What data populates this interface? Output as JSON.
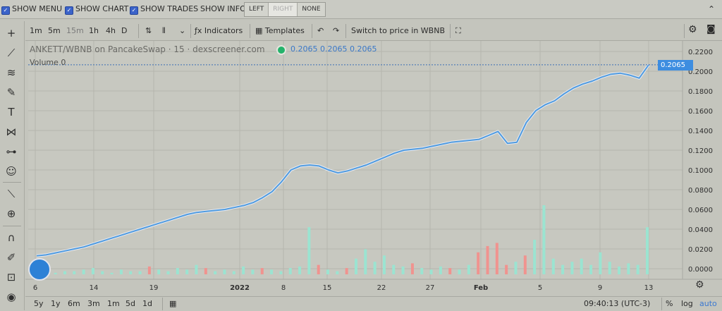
{
  "topbar": {
    "show_menu": "SHOW MENU",
    "show_chart": "SHOW CHART",
    "show_trades": "SHOW TRADES",
    "show_info": "SHOW INFO:",
    "info_options": [
      "LEFT",
      "RIGHT",
      "NONE"
    ],
    "info_selected": "RIGHT",
    "collapse_icon": "chevron-up-icon"
  },
  "toolbar": {
    "intervals": [
      "1m",
      "5m",
      "15m",
      "1h",
      "4h",
      "D"
    ],
    "selected_interval": "15m",
    "indicators_label": "Indicators",
    "templates_label": "Templates",
    "switch_label": "Switch to price in WBNB",
    "icons": [
      "candles-icon",
      "bar-type-icon",
      "chevron-down-icon",
      "indicators-icon",
      "templates-icon",
      "undo-icon",
      "redo-icon",
      "fullscreen-icon",
      "gear-icon",
      "camera-icon"
    ]
  },
  "left_tools": [
    "crosshair-icon",
    "trendline-icon",
    "fib-icon",
    "brush-icon",
    "text-icon",
    "pattern-icon",
    "projection-icon",
    "emoji-icon",
    "ruler-icon",
    "zoom-icon",
    "magnet-icon",
    "lock-draw-icon",
    "lock-icon",
    "eye-icon"
  ],
  "legend": {
    "title": "ANKETT/WBNB on PancakeSwap · 15 · dexscreener.com",
    "ohlc": "0.2065 0.2065 0.2065",
    "volume": "Volume 0"
  },
  "price_label": "0.2065",
  "colors": {
    "price_line": "#4f9be0",
    "volume_up": "#9be4d1",
    "volume_down": "#f0938f",
    "accent": "#3d8de0"
  },
  "chart_data": {
    "type": "line",
    "x_ticks": [
      "6",
      "14",
      "19",
      "2022",
      "8",
      "15",
      "22",
      "27",
      "Feb",
      "5",
      "9",
      "13"
    ],
    "y_ticks": [
      "0.2200",
      "0.2000",
      "0.1800",
      "0.1600",
      "0.1400",
      "0.1200",
      "0.1000",
      "0.0800",
      "0.0600",
      "0.0400",
      "0.0200",
      "0.0000"
    ],
    "ylim": [
      0,
      0.22
    ],
    "series": [
      {
        "values": [
          0.013,
          0.014,
          0.016,
          0.018,
          0.02,
          0.022,
          0.025,
          0.028,
          0.031,
          0.034,
          0.037,
          0.04,
          0.043,
          0.046,
          0.049,
          0.052,
          0.055,
          0.057,
          0.058,
          0.059,
          0.06,
          0.062,
          0.064,
          0.067,
          0.072,
          0.078,
          0.088,
          0.1,
          0.104,
          0.105,
          0.104,
          0.1,
          0.097,
          0.099,
          0.102,
          0.105,
          0.109,
          0.113,
          0.117,
          0.12,
          0.121,
          0.122,
          0.124,
          0.126,
          0.128,
          0.129,
          0.13,
          0.131,
          0.135,
          0.139,
          0.127,
          0.128,
          0.148,
          0.16,
          0.166,
          0.17,
          0.177,
          0.183,
          0.187,
          0.19,
          0.194,
          0.197,
          0.198,
          0.196,
          0.193,
          0.2065
        ]
      }
    ],
    "volume": [
      2,
      3,
      1,
      2,
      2,
      3,
      4,
      2,
      1,
      3,
      2,
      2,
      5,
      3,
      2,
      4,
      3,
      6,
      4,
      2,
      3,
      2,
      5,
      3,
      4,
      3,
      2,
      4,
      5,
      30,
      6,
      3,
      2,
      4,
      10,
      16,
      8,
      12,
      6,
      5,
      7,
      4,
      3,
      5,
      4,
      3,
      6,
      14,
      18,
      20,
      6,
      8,
      12,
      22,
      44,
      10,
      6,
      8,
      10,
      6,
      14,
      8,
      5,
      7,
      6,
      30
    ],
    "volume_down_indices": [
      12,
      18,
      24,
      30,
      33,
      40,
      44,
      47,
      48,
      49,
      50,
      52
    ],
    "grid": true,
    "price_line_label": "0.2065"
  },
  "bottombar": {
    "ranges": [
      "5y",
      "1y",
      "6m",
      "3m",
      "1m",
      "5d",
      "1d"
    ],
    "time": "09:40:13 (UTC-3)",
    "percent": "%",
    "log": "log",
    "auto": "auto",
    "calendar_icon": "calendar-icon",
    "settings_icon": "gear-icon"
  }
}
